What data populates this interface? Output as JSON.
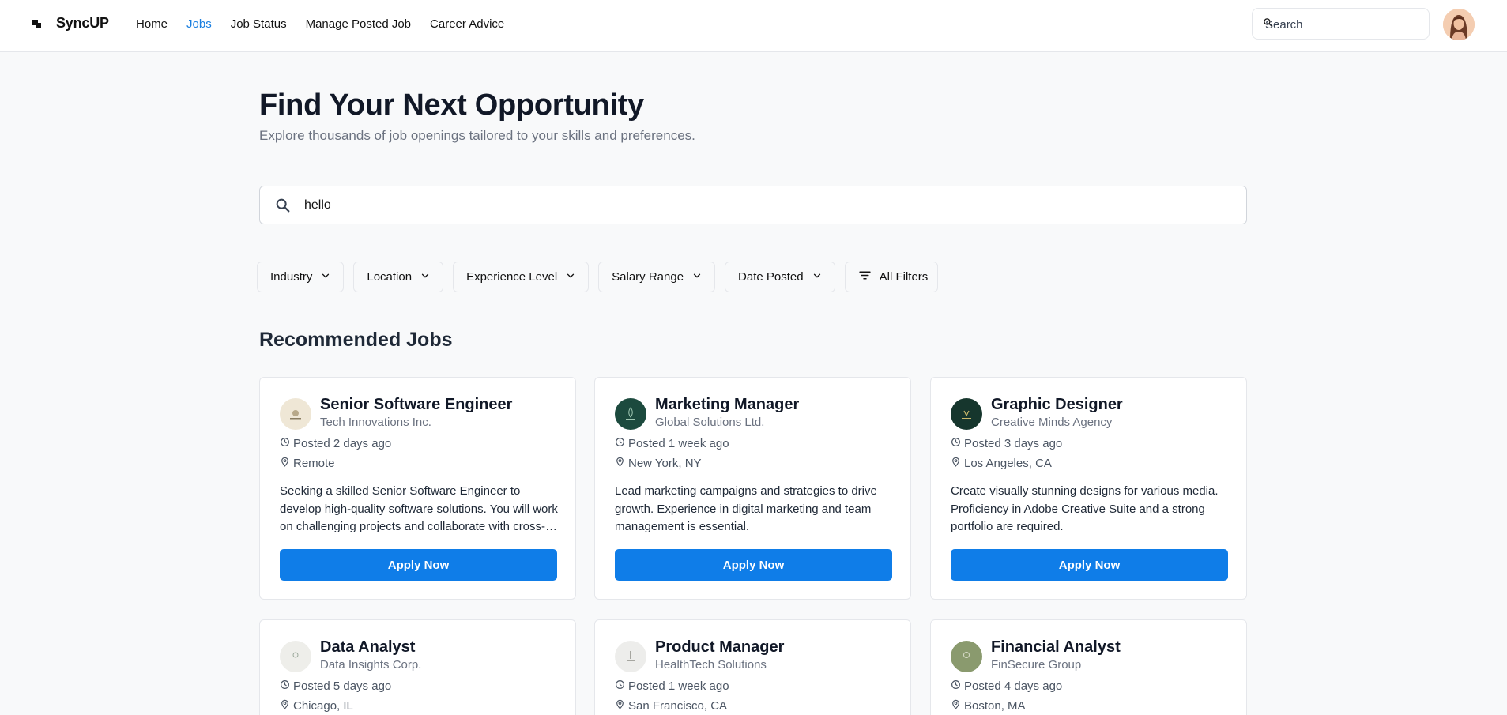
{
  "header": {
    "brand": "SyncUP",
    "nav": [
      {
        "label": "Home",
        "active": false
      },
      {
        "label": "Jobs",
        "active": true
      },
      {
        "label": "Job Status",
        "active": false
      },
      {
        "label": "Manage Posted Job",
        "active": false
      },
      {
        "label": "Career Advice",
        "active": false
      }
    ],
    "search_placeholder": "Search",
    "search_icon": "search-icon",
    "avatar": "user-avatar"
  },
  "hero": {
    "title": "Find Your Next Opportunity",
    "subtitle": "Explore thousands of job openings tailored to your skills and preferences."
  },
  "search": {
    "value": "hello"
  },
  "filters": [
    {
      "label": "Industry"
    },
    {
      "label": "Location"
    },
    {
      "label": "Experience Level"
    },
    {
      "label": "Salary Range"
    },
    {
      "label": "Date Posted"
    },
    {
      "label": "All Filters",
      "icon": "filter-lines-icon"
    }
  ],
  "recommended": {
    "title": "Recommended Jobs",
    "apply_label": "Apply Now",
    "jobs": [
      {
        "title": "Senior Software Engineer",
        "company": "Tech Innovations Inc.",
        "posted": "Posted 2 days ago",
        "location": "Remote",
        "description": "Seeking a skilled Senior Software Engineer to develop high-quality software solutions. You will work on challenging projects and collaborate with cross-functional teams.",
        "logo_bg": "#efe7d6"
      },
      {
        "title": "Marketing Manager",
        "company": "Global Solutions Ltd.",
        "posted": "Posted 1 week ago",
        "location": "New York, NY",
        "description": "Lead marketing campaigns and strategies to drive growth. Experience in digital marketing and team management is essential.",
        "logo_bg": "#1c4a3e"
      },
      {
        "title": "Graphic Designer",
        "company": "Creative Minds Agency",
        "posted": "Posted 3 days ago",
        "location": "Los Angeles, CA",
        "description": "Create visually stunning designs for various media. Proficiency in Adobe Creative Suite and a strong portfolio are required.",
        "logo_bg": "#16362d"
      },
      {
        "title": "Data Analyst",
        "company": "Data Insights Corp.",
        "posted": "Posted 5 days ago",
        "location": "Chicago, IL",
        "description": "",
        "logo_bg": "#eeeeea"
      },
      {
        "title": "Product Manager",
        "company": "HealthTech Solutions",
        "posted": "Posted 1 week ago",
        "location": "San Francisco, CA",
        "description": "",
        "logo_bg": "#ededeb"
      },
      {
        "title": "Financial Analyst",
        "company": "FinSecure Group",
        "posted": "Posted 4 days ago",
        "location": "Boston, MA",
        "description": "",
        "logo_bg": "#8a9a6e"
      }
    ]
  }
}
